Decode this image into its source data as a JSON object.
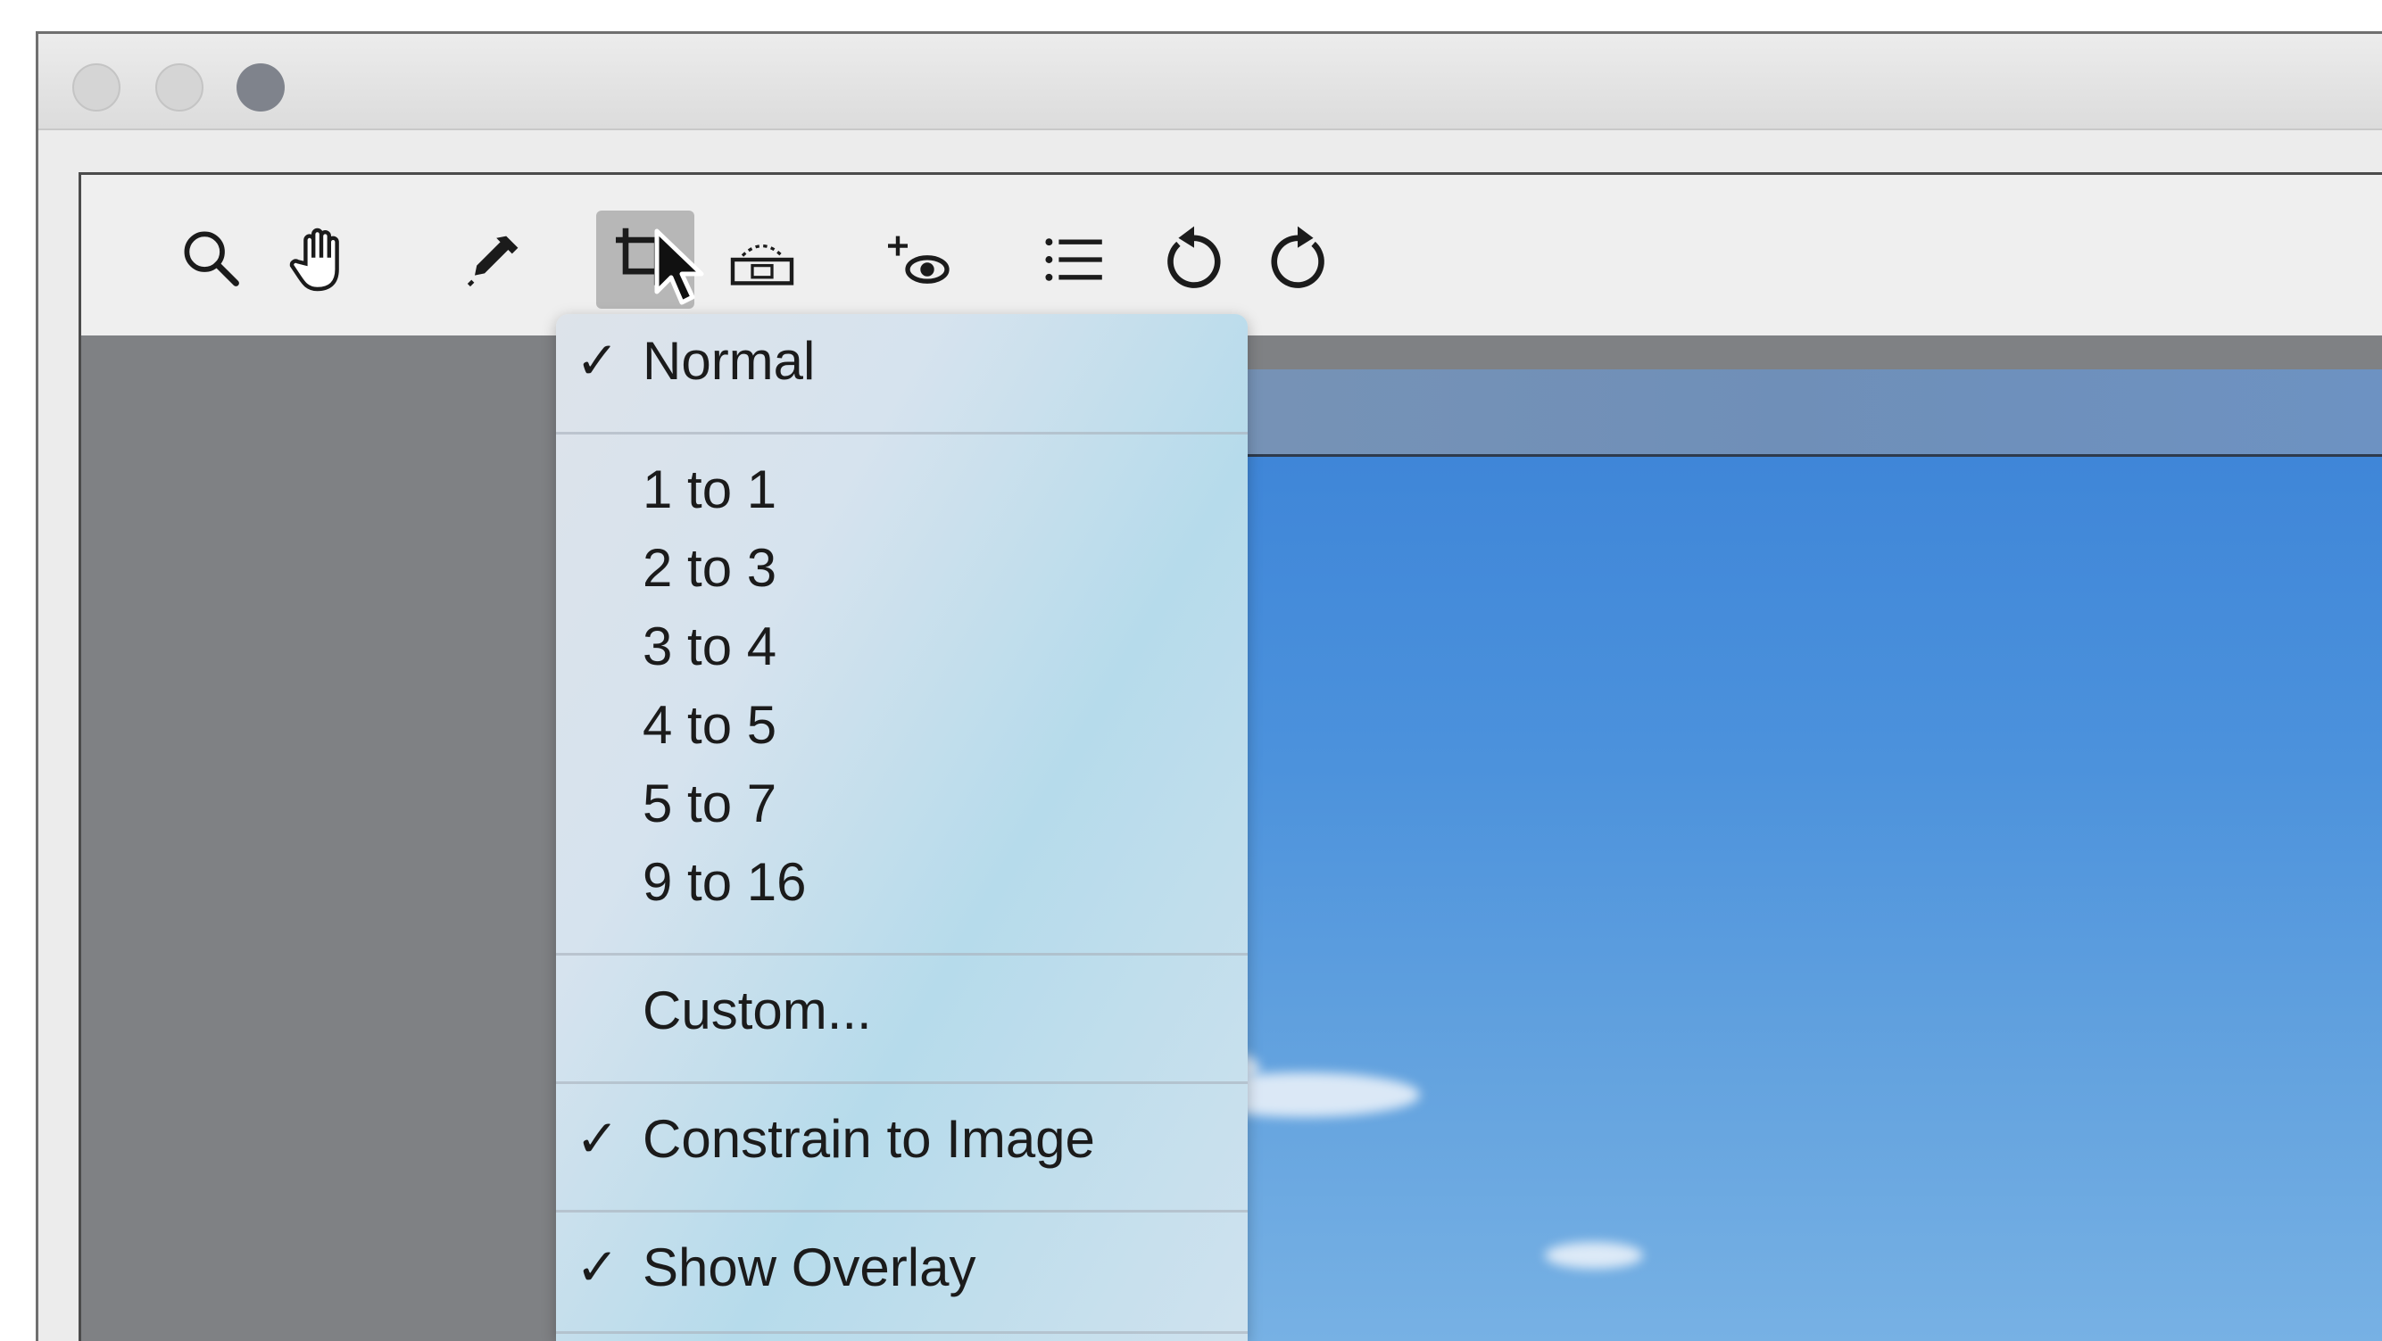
{
  "window": {
    "traffic_lights": [
      "close",
      "minimize",
      "zoom"
    ]
  },
  "toolbar": {
    "tools": [
      {
        "icon": "zoom-icon"
      },
      {
        "icon": "hand-icon"
      },
      {
        "icon": "eyedropper-icon"
      },
      {
        "icon": "crop-icon",
        "active": true
      },
      {
        "icon": "straighten-icon"
      },
      {
        "icon": "red-eye-icon"
      },
      {
        "icon": "list-icon"
      },
      {
        "icon": "rotate-left-icon"
      },
      {
        "icon": "rotate-right-icon"
      }
    ]
  },
  "crop_menu": {
    "normal": {
      "label": "Normal",
      "checked": true
    },
    "ratios": [
      {
        "label": "1 to 1"
      },
      {
        "label": "2 to 3"
      },
      {
        "label": "3 to 4"
      },
      {
        "label": "4 to 5"
      },
      {
        "label": "5 to 7"
      },
      {
        "label": "9 to 16"
      }
    ],
    "custom": {
      "label": "Custom..."
    },
    "constrain": {
      "label": "Constrain to Image",
      "checked": true
    },
    "overlay": {
      "label": "Show Overlay",
      "checked": true
    },
    "check_glyph": "✓"
  },
  "colors": {
    "sky": "#4c92dc",
    "pane_background": "#7f8184",
    "toolbar_background": "#efefef"
  }
}
